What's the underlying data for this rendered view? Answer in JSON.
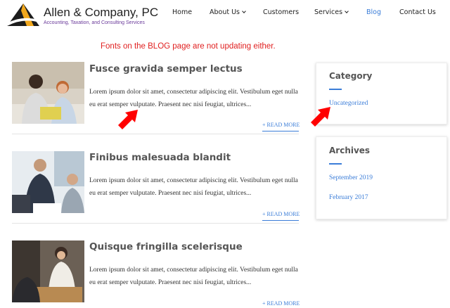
{
  "header": {
    "brand_name": "Allen & Company, PC",
    "brand_tagline": "Accounting, Taxation, and Consulting Services",
    "nav": {
      "home": "Home",
      "about": "About Us",
      "customers": "Customers",
      "services": "Services",
      "blog": "Blog",
      "contact": "Contact Us"
    },
    "accent_color": "#3b7dd8"
  },
  "notice": "Fonts on the BLOG page are not updating either.",
  "posts": [
    {
      "title": "Fusce gravida semper lectus",
      "excerpt": "Lorem ipsum dolor sit amet, consectetur adipiscing elit. Vestibulum eget nulla eu erat semper vulputate. Praesent nec nisi feugiat, ultrices...",
      "read_more": "+ READ MORE"
    },
    {
      "title": "Finibus malesuada blandit",
      "excerpt": "Lorem ipsum dolor sit amet, consectetur adipiscing elit. Vestibulum eget nulla eu erat semper vulputate. Praesent nec nisi feugiat, ultrices...",
      "read_more": "+ READ MORE"
    },
    {
      "title": "Quisque fringilla scelerisque",
      "excerpt": "Lorem ipsum dolor sit amet, consectetur adipiscing elit. Vestibulum eget nulla eu erat semper vulputate. Praesent nec nisi feugiat, ultrices...",
      "read_more": "+ READ MORE"
    }
  ],
  "sidebar": {
    "category": {
      "title": "Category",
      "items": [
        "Uncategorized"
      ]
    },
    "archives": {
      "title": "Archives",
      "items": [
        "September 2019",
        "February 2017"
      ]
    }
  },
  "annotation_color": "#ff0000"
}
